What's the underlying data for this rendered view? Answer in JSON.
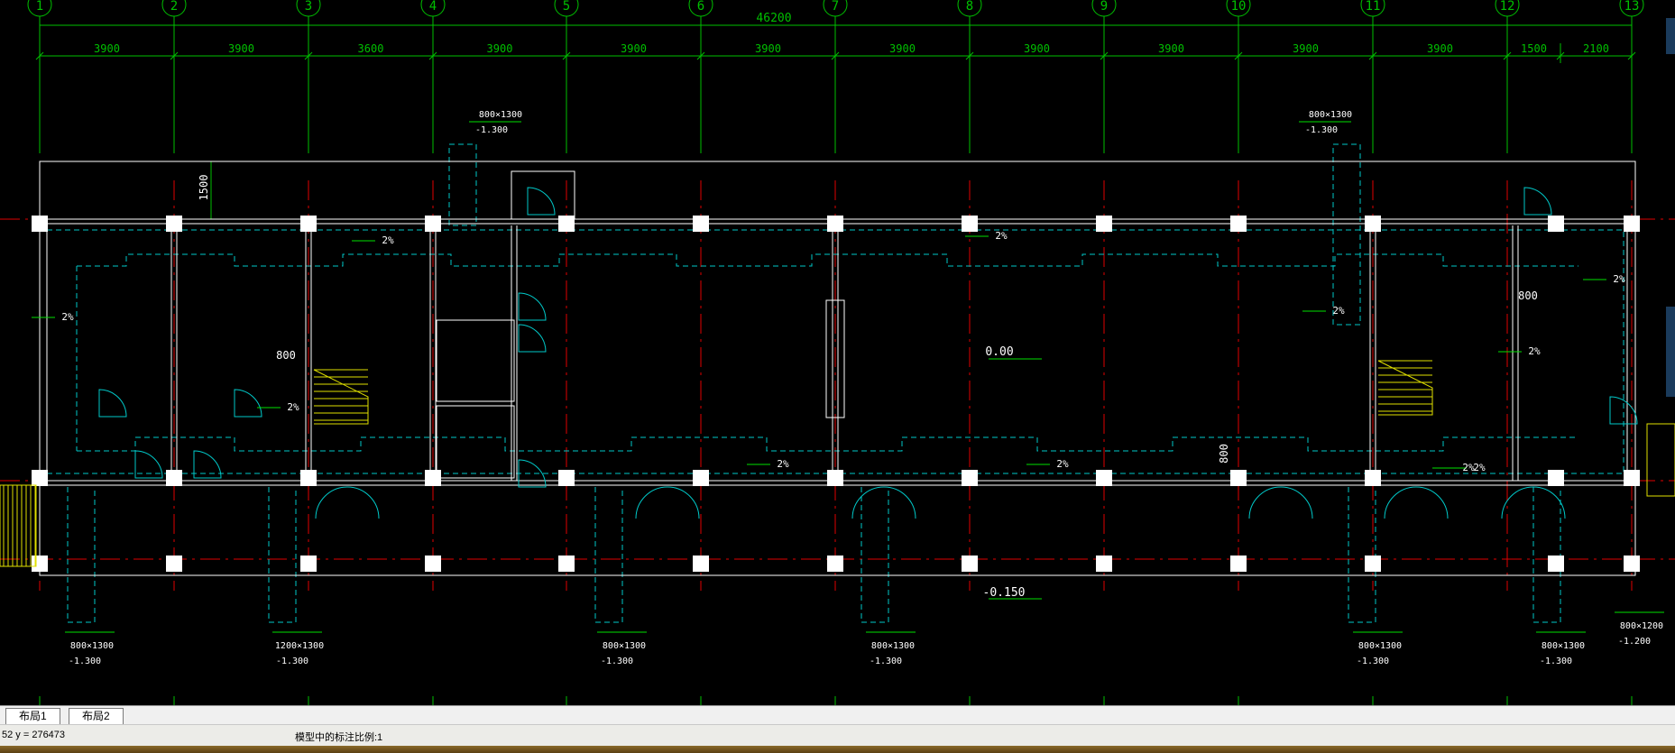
{
  "colors": {
    "background": "#000000",
    "axis": "#00c000",
    "wall": "#ffffff",
    "column_fill": "#ffffff",
    "centerline": "#e00000",
    "dashed": "#00c8c8",
    "door": "#00c8c8",
    "stair": "#e0e000",
    "slope": "#00e000"
  },
  "drawing": {
    "axis_labels": [
      "1",
      "2",
      "3",
      "4",
      "5",
      "6",
      "7",
      "8",
      "9",
      "10",
      "11",
      "12",
      "13"
    ],
    "overall_dimension": "46200",
    "spacing_dimensions": [
      "3900",
      "3900",
      "3600",
      "3900",
      "3900",
      "3900",
      "3900",
      "3900",
      "3900",
      "3900",
      "3900",
      "1500",
      "2100"
    ],
    "dim_1500": "1500",
    "dim_800_a": "800",
    "dim_800_b": "800",
    "dim_800_c": "800",
    "floor_level": "0.00",
    "outdoor_level": "-0.150",
    "slope_labels": [
      "2%",
      "2%",
      "2%",
      "2%",
      "2%",
      "2%",
      "2%",
      "2%",
      "2%",
      "2%",
      "2%"
    ],
    "windows_top": [
      {
        "size": "800×1300",
        "elev": "-1.300"
      },
      {
        "size": "800×1300",
        "elev": "-1.300"
      }
    ],
    "windows_bottom": [
      {
        "size": "800×1300",
        "elev": "-1.300"
      },
      {
        "size": "1200×1300",
        "elev": "-1.300"
      },
      {
        "size": "800×1300",
        "elev": "-1.300"
      },
      {
        "size": "800×1300",
        "elev": "-1.300"
      },
      {
        "size": "800×1300",
        "elev": "-1.300"
      },
      {
        "size": "800×1300",
        "elev": "-1.300"
      },
      {
        "size": "800×1200",
        "elev": "-1.200"
      }
    ]
  },
  "tabs": [
    "布局1",
    "布局2"
  ],
  "status": {
    "coords": "52 y = 276473",
    "annotation_scale": "模型中的标注比例:1"
  }
}
